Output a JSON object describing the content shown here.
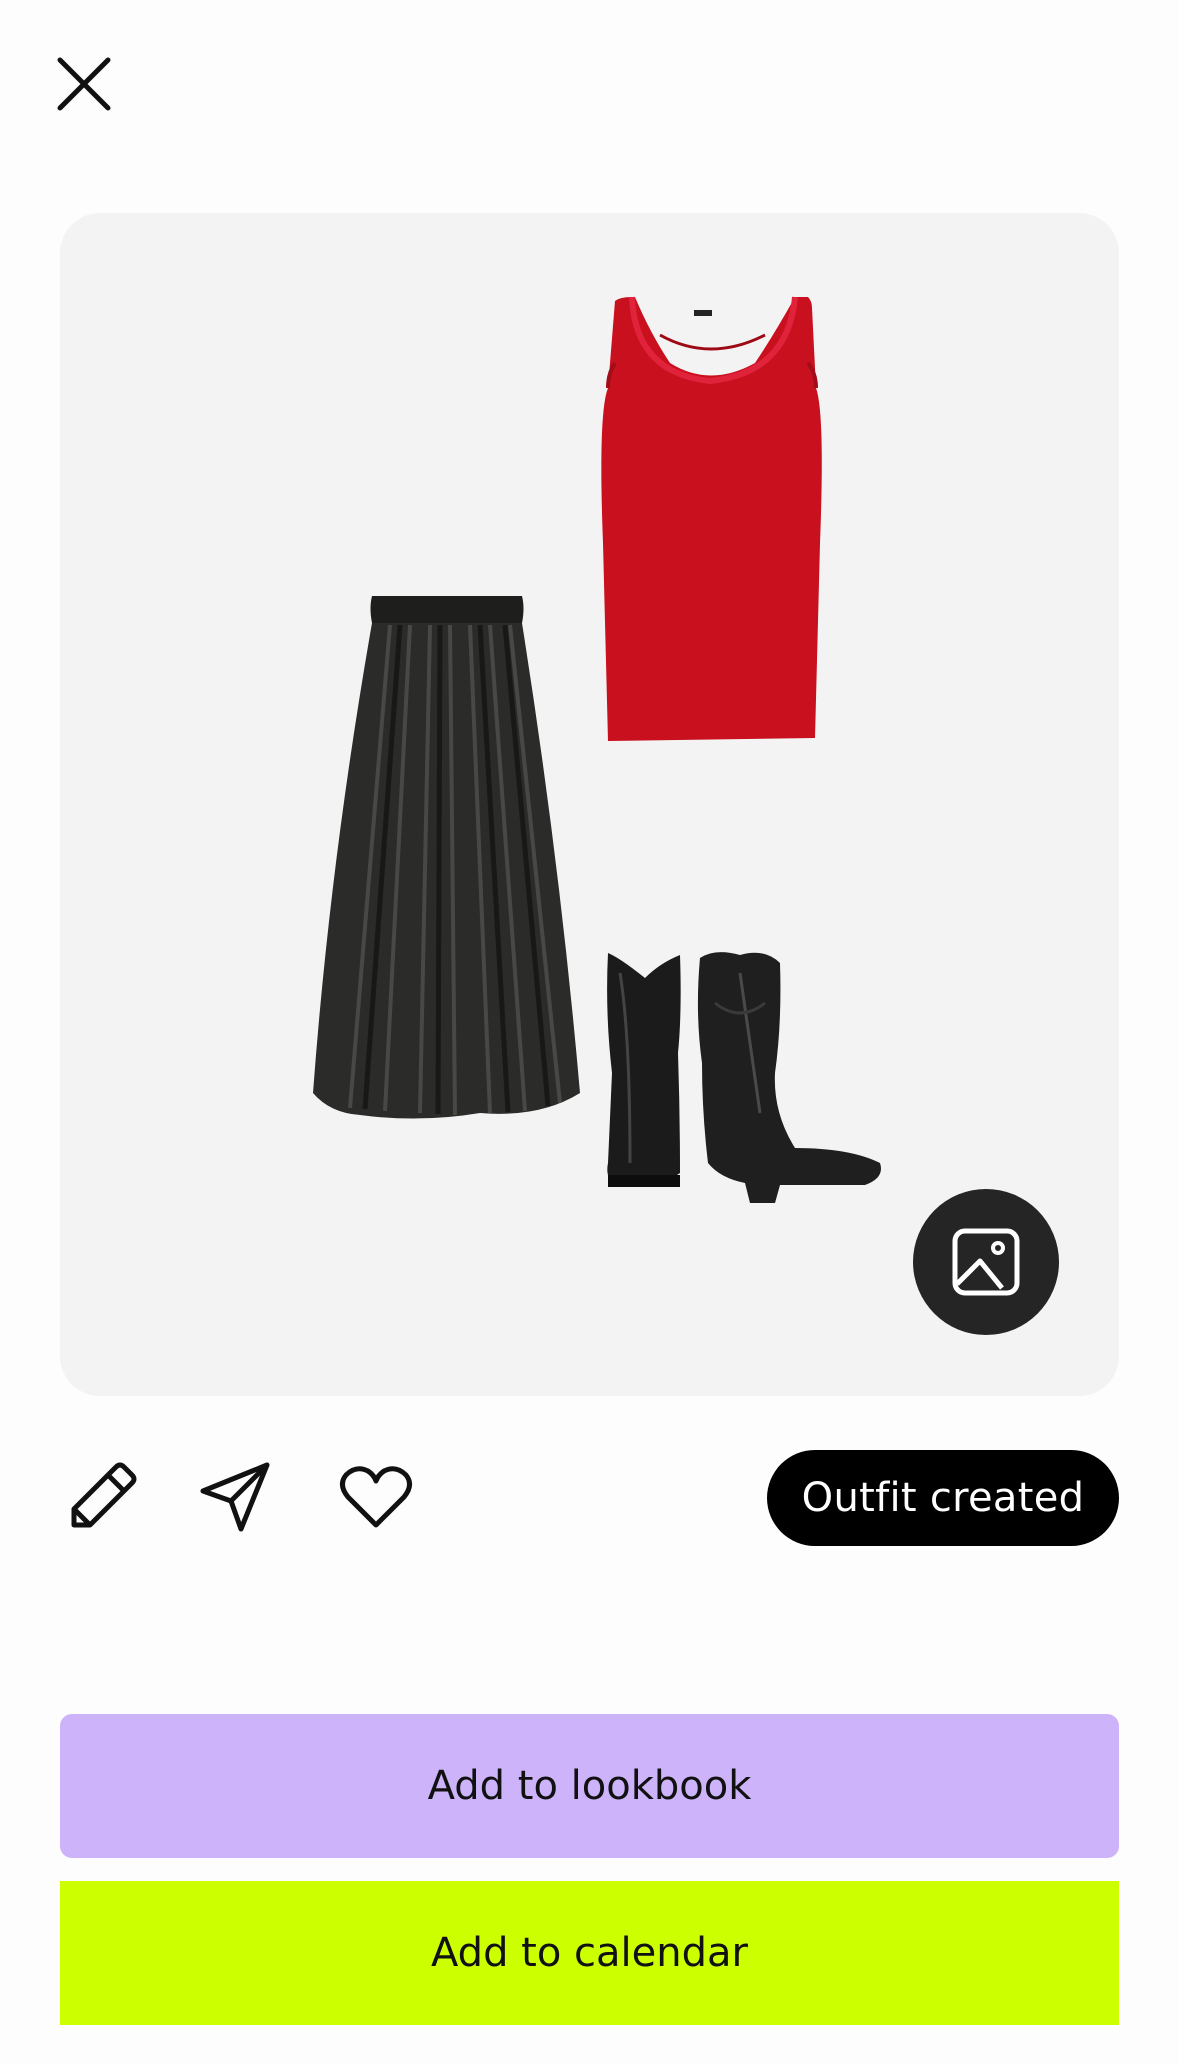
{
  "header": {
    "close_icon": "close-icon"
  },
  "outfit": {
    "items": [
      {
        "name": "red-tank-top",
        "color": "#c8101e"
      },
      {
        "name": "black-pleated-skirt",
        "color": "#2a2a28"
      },
      {
        "name": "black-cowboy-boots",
        "color": "#1b1b1b"
      }
    ],
    "gallery_icon": "image-icon"
  },
  "actions": {
    "icons": [
      "pencil-icon",
      "send-icon",
      "heart-icon"
    ],
    "badge_label": "Outfit created"
  },
  "buttons": {
    "lookbook_label": "Add to lookbook",
    "calendar_label": "Add to calendar"
  },
  "colors": {
    "lookbook": "#cdb3fa",
    "calendar": "#ccff00",
    "badge": "#000000",
    "canvas": "#f4f3f3"
  }
}
